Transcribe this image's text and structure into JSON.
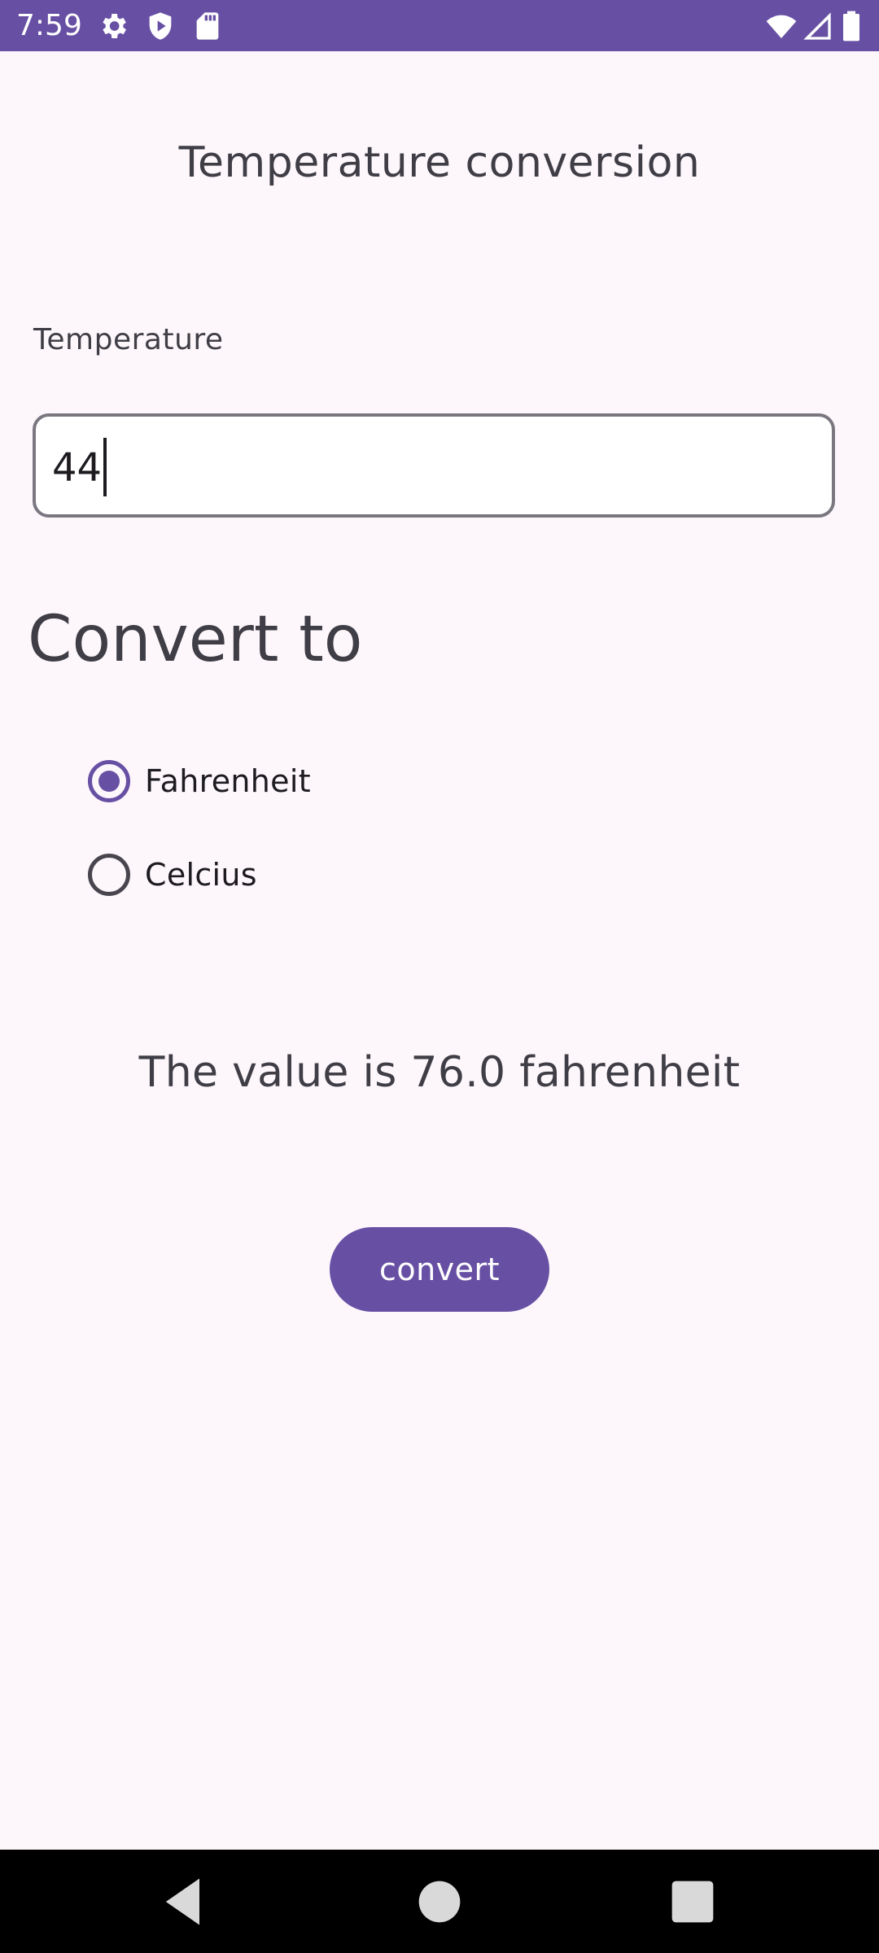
{
  "status_bar": {
    "time": "7:59",
    "left_icons": [
      "gear-icon",
      "shield-play-icon",
      "sd-card-icon"
    ],
    "right_icons": [
      "wifi-icon",
      "cell-signal-icon",
      "battery-icon"
    ],
    "background_color": "#6750a4"
  },
  "app": {
    "title": "Temperature conversion",
    "input": {
      "label": "Temperature",
      "value": "44"
    },
    "convert_to": {
      "heading": "Convert to",
      "options": [
        {
          "label": "Fahrenheit",
          "selected": true
        },
        {
          "label": "Celcius",
          "selected": false
        }
      ]
    },
    "result_text": "The value is 76.0 fahrenheit",
    "convert_button_label": "convert",
    "accent_color": "#6750a4"
  },
  "nav_bar": {
    "buttons": [
      "back-icon",
      "home-icon",
      "recents-icon"
    ]
  }
}
